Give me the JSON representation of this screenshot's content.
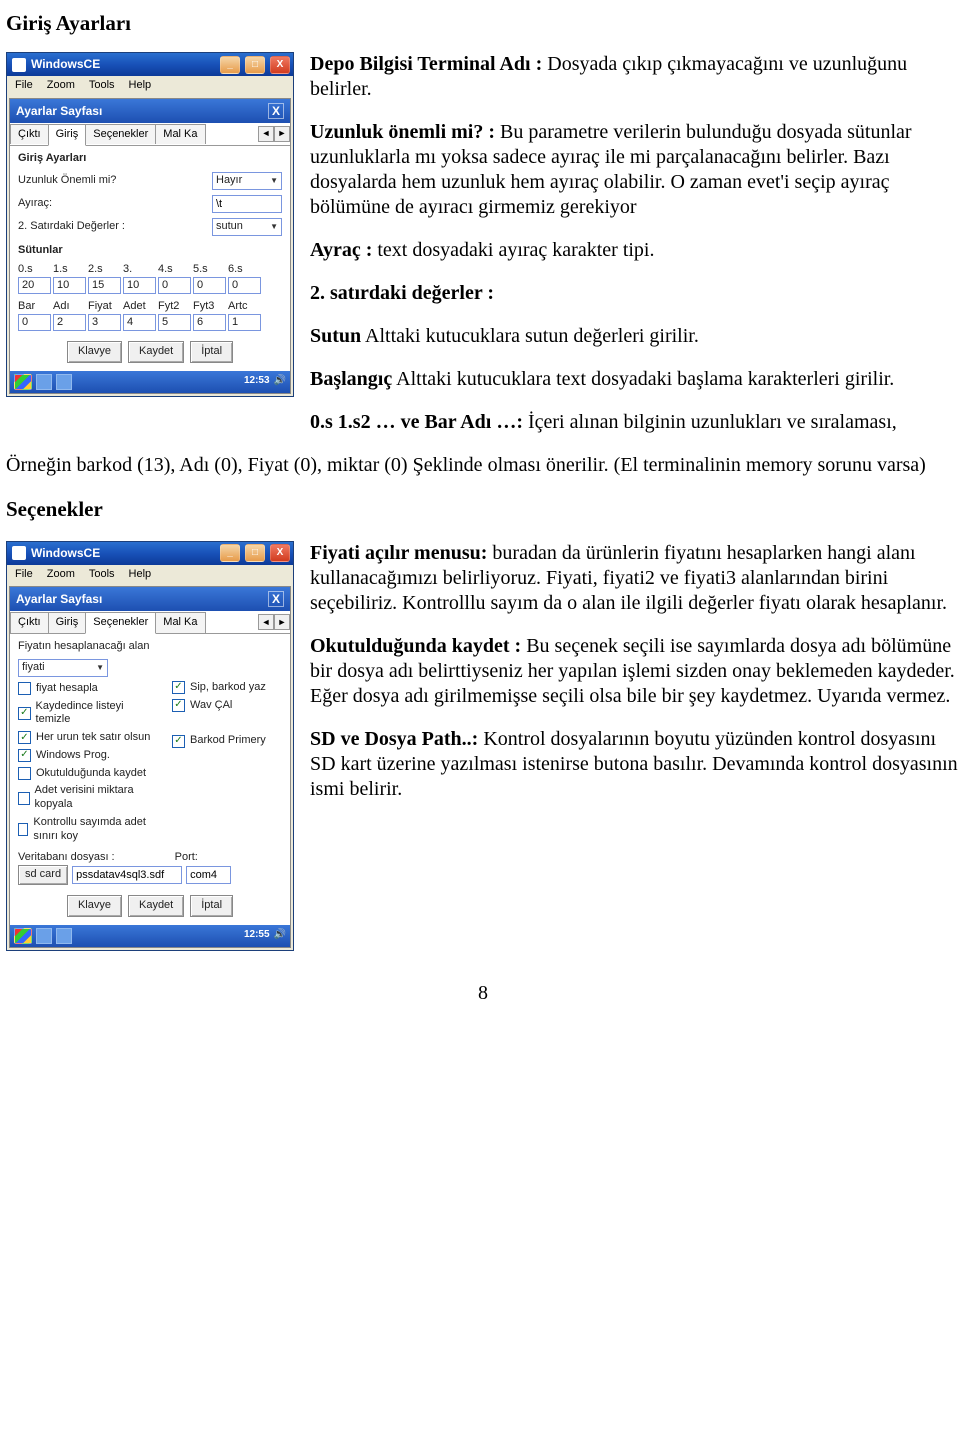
{
  "section1_title": "Giriş Ayarları",
  "section2_title": "Seçenekler",
  "page_number": "8",
  "win": {
    "title": "WindowsCE",
    "menu": {
      "file": "File",
      "zoom": "Zoom",
      "tools": "Tools",
      "help": "Help"
    },
    "btn_min": "_",
    "btn_max": "□",
    "btn_close": "X"
  },
  "ce": {
    "header": "Ayarlar Sayfası",
    "close": "X",
    "tabs": {
      "cikti": "Çıktı",
      "giris": "Giriş",
      "secenekler": "Seçenekler",
      "malka": "Mal Ka"
    },
    "arrows": {
      "left": "◄",
      "right": "►"
    },
    "buttons": {
      "klavye": "Klavye",
      "kaydet": "Kaydet",
      "iptal": "İptal"
    }
  },
  "giris": {
    "section_label": "Giriş Ayarları",
    "uzunluk_label": "Uzunluk Önemli mi?",
    "uzunluk_value": "Hayır",
    "ayrac_label": "Ayıraç:",
    "ayrac_value": "\\t",
    "satir2_label": "2. Satırdaki Değerler :",
    "satir2_value": "sutun",
    "sutunlar_label": "Sütunlar",
    "col_headers": [
      "0.s",
      "1.s",
      "2.s",
      "3.",
      "4.s",
      "5.s",
      "6.s"
    ],
    "col_row1": [
      "20",
      "10",
      "15",
      "10",
      "0",
      "0",
      "0"
    ],
    "col_row2_labels": [
      "Bar",
      "Adı",
      "Fiyat",
      "Adet",
      "Fyt2",
      "Fyt3",
      "Artc"
    ],
    "col_row2": [
      "0",
      "2",
      "3",
      "4",
      "5",
      "6",
      "1"
    ],
    "time": "12:53"
  },
  "secenek": {
    "section_label": "Fiyatın hesaplanacağı alan",
    "fiyati_value": "fiyati",
    "left": {
      "fiyat_hesapla": "fiyat hesapla",
      "kaydedince": "Kaydedince listeyi temizle",
      "her_urun": "Her urun tek satır olsun",
      "windows_prog": "Windows Prog.",
      "okutuldugunda": "Okutulduğunda kaydet",
      "adet_verisini": "Adet verisini miktara kopyala",
      "kontrollu": "Kontrollu sayımda adet sınırı koy"
    },
    "right": {
      "sip_barkod": "Sip, barkod yaz",
      "wav_cal": "Wav ÇAl",
      "barkod_primery": "Barkod Primery"
    },
    "db_label": "Veritabanı dosyası :",
    "port_label": "Port:",
    "db_btn": "sd card",
    "db_file": "pssdatav4sql3.sdf",
    "port_value": "com4",
    "time": "12:55"
  },
  "text1": {
    "p1a": "Depo Bilgisi Terminal Adı :",
    "p1b": " Dosyada çıkıp çıkmayacağını ve uzunluğunu belirler.",
    "p2a": "Uzunluk önemli mi? :",
    "p2b": " Bu parametre verilerin bulunduğu dosyada sütunlar uzunluklarla mı yoksa sadece ayıraç ile mi parçalanacağını belirler. Bazı dosyalarda hem uzunluk hem ayıraç olabilir. O zaman    evet'i seçip ayıraç bölümüne de ayıracı girmemiz gerekiyor",
    "p3a": "Ayraç :",
    "p3b": " text dosyadaki ayıraç karakter tipi.",
    "p4a": "2. satırdaki değerler :",
    "p5a": "Sutun",
    "p5b": " Alttaki kutucuklara sutun değerleri girilir.",
    "p6a": "Başlangıç",
    "p6b": " Alttaki kutucuklara text dosyadaki başlama karakterleri girilir.",
    "p7a": "0.s 1.s2 … ve Bar Adı …:",
    "p7b": "  İçeri alınan bilginin uzunlukları ve sıralaması,",
    "p8": "Örneğin barkod (13), Adı (0), Fiyat (0), miktar (0)  Şeklinde olması önerilir. (El terminalinin  memory sorunu varsa)"
  },
  "text2": {
    "p1a": "Fiyati açılır menusu:",
    "p1b": " buradan da ürünlerin fiyatını hesaplarken hangi alanı kullanacağımızı belirliyoruz. Fiyati, fiyati2 ve fiyati3 alanlarından birini seçebiliriz. Kontrolllu sayım da o alan ile ilgili değerler fiyatı olarak hesaplanır.",
    "p2a": "Okutulduğunda kaydet :",
    "p2b": "  Bu seçenek seçili ise sayımlarda dosya adı bölümüne bir dosya adı belirttiyseniz her yapılan işlemi sizden onay beklemeden kaydeder. Eğer dosya adı girilmemişse seçili olsa bile bir şey kaydetmez. Uyarıda vermez.",
    "p3a": "SD ve Dosya Path..:",
    "p3b": " Kontrol dosyalarının boyutu yüzünden kontrol dosyasını SD kart üzerine yazılması istenirse butona basılır. Devamında kontrol dosyasının ismi belirir."
  }
}
